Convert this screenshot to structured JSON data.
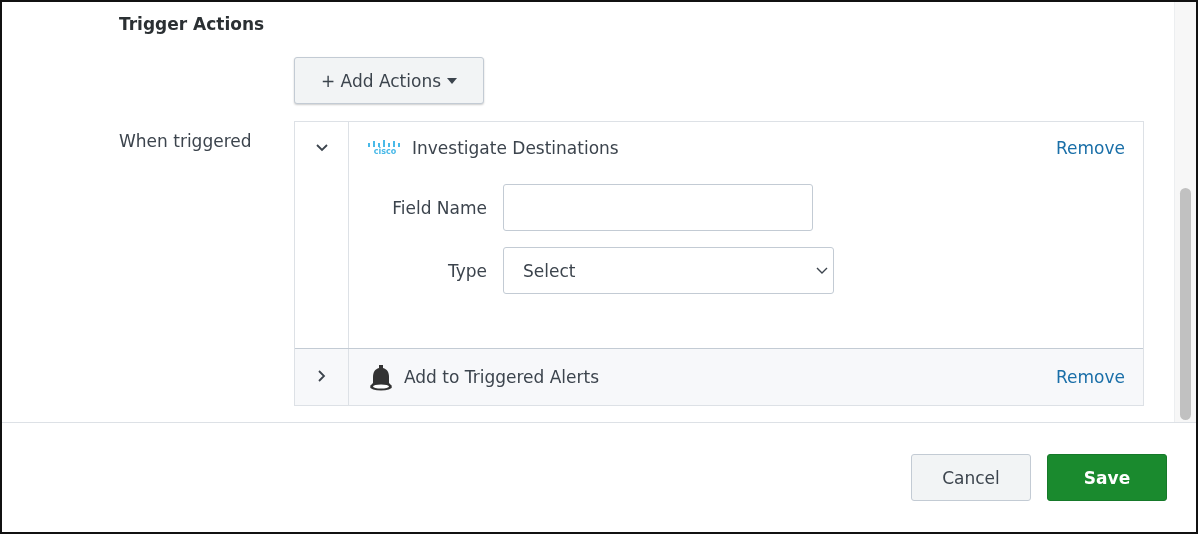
{
  "section_title": "Trigger Actions",
  "add_button": {
    "label": "+ Add Actions"
  },
  "when_label": "When triggered",
  "actions": [
    {
      "title": "Investigate Destinations",
      "logo_text": "cisco",
      "expanded": true,
      "remove": "Remove",
      "fields": [
        {
          "kind": "text",
          "label": "Field Name"
        },
        {
          "kind": "select",
          "label": "Type",
          "value": "Select"
        }
      ]
    },
    {
      "title": "Add to Triggered Alerts",
      "expanded": false,
      "remove": "Remove"
    }
  ],
  "footer": {
    "cancel": "Cancel",
    "save": "Save"
  }
}
